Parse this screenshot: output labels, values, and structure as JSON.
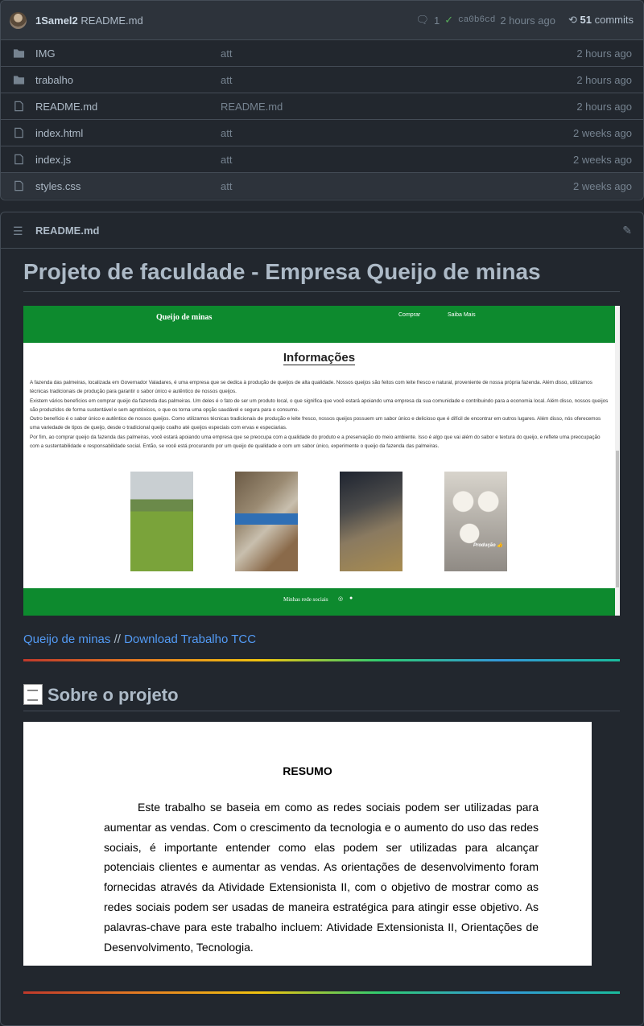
{
  "commit": {
    "user": "1Samel2",
    "file": "README.md",
    "comments": "1",
    "hash": "ca0b6cd",
    "time": "2 hours ago",
    "count": "51",
    "count_label": "commits"
  },
  "files": [
    {
      "name": "IMG",
      "type": "folder",
      "message": "att",
      "age": "2 hours ago"
    },
    {
      "name": "trabalho",
      "type": "folder",
      "message": "att",
      "age": "2 hours ago"
    },
    {
      "name": "README.md",
      "type": "file",
      "message": "README.md",
      "age": "2 hours ago"
    },
    {
      "name": "index.html",
      "type": "file",
      "message": "att",
      "age": "2 weeks ago"
    },
    {
      "name": "index.js",
      "type": "file",
      "message": "att",
      "age": "2 weeks ago"
    },
    {
      "name": "styles.css",
      "type": "file",
      "message": "att",
      "age": "2 weeks ago"
    }
  ],
  "readme": {
    "title": "README.md",
    "h1": "Projeto de faculdade - Empresa Queijo de minas",
    "shot": {
      "brand": "Queijo de minas",
      "nav1": "Comprar",
      "nav2": "Saiba Mais",
      "heading": "Informações",
      "text": "A fazenda das palmeiras, localizada em Governador Valadares, é uma empresa que se dedica à produção de queijos de alta qualidade. Nossos queijos são feitos com leite fresco e natural, proveniente de nossa própria fazenda. Além disso, utilizamos técnicas tradicionais de produção para garantir o sabor único e autêntico de nossos queijos.\nExistem vários benefícios em comprar queijo da fazenda das palmeiras. Um deles é o fato de ser um produto local, o que significa que você estará apoiando uma empresa da sua comunidade e contribuindo para a economia local. Além disso, nossos queijos são produzidos de forma sustentável e sem agrotóxicos, o que os torna uma opção saudável e segura para o consumo.\nOutro benefício é o sabor único e autêntico de nossos queijos. Como utilizamos técnicas tradicionais de produção e leite fresco, nossos queijos possuem um sabor único e delicioso que é difícil de encontrar em outros lugares. Além disso, nós oferecemos uma variedade de tipos de queijo, desde o tradicional queijo coalho até queijos especiais com ervas e especiarias.\nPor fim, ao comprar queijo da fazenda das palmeiras, você estará apoiando uma empresa que se preocupa com a qualidade do produto e a preservação do meio ambiente. Isso é algo que vai além do sabor e textura do queijo, e reflete uma preocupação com a sustentabilidade e responsabilidade social. Então, se você está procurando por um queijo de qualidade e com um sabor único, experimente o queijo da fazenda das palmeiras.",
      "photo_caption": "Produção 👍",
      "footer": "Minhas rede sociais"
    },
    "link1": "Queijo de minas",
    "sep": " // ",
    "link2": "Download Trabalho TCC",
    "h2": "Sobre o projeto",
    "doc": {
      "title": "RESUMO",
      "body": "Este trabalho se baseia em como as redes sociais podem ser utilizadas para aumentar as vendas. Com o crescimento da tecnologia e o aumento do uso das redes sociais, é importante entender como elas podem ser utilizadas para alcançar potenciais clientes e aumentar as vendas. As orientações de desenvolvimento foram fornecidas através da Atividade Extensionista II, com o objetivo de mostrar como as redes sociais podem ser usadas de maneira estratégica para atingir esse objetivo. As palavras-chave para este trabalho incluem: Atividade Extensionista II, Orientações de Desenvolvimento, Tecnologia."
    }
  }
}
